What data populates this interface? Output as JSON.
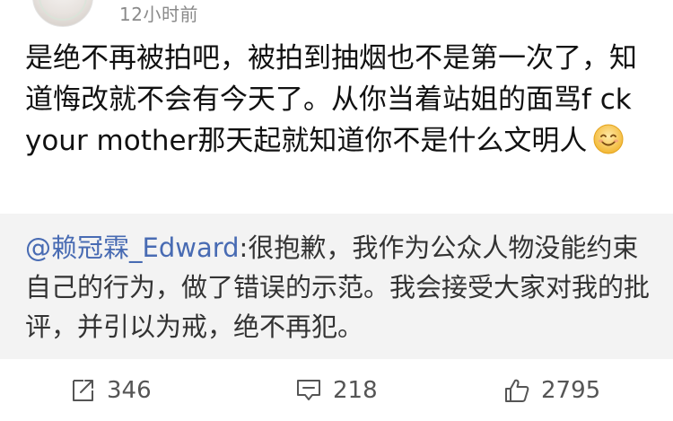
{
  "post": {
    "time": "12小时前",
    "text": "是绝不再被拍吧，被拍到抽烟也不是第一次了，知道悔改就不会有今天了。从你当着站姐的面骂f ck your mother那天起就知道你不是什么文明人",
    "emoji": "smile-emoji-icon"
  },
  "quote": {
    "mention": "@赖冠霖_Edward",
    "text": ":很抱歉，我作为公众人物没能约束自己的行为，做了错误的示范。我会接受大家对我的批评，并引以为戒，绝不再犯。"
  },
  "actions": {
    "repost_count": "346",
    "comment_count": "218",
    "like_count": "2795"
  },
  "colors": {
    "text": "#111111",
    "secondary": "#8a8a8a",
    "link": "#486bb3",
    "quote_bg": "#f3f3f3",
    "icon": "#555555"
  }
}
